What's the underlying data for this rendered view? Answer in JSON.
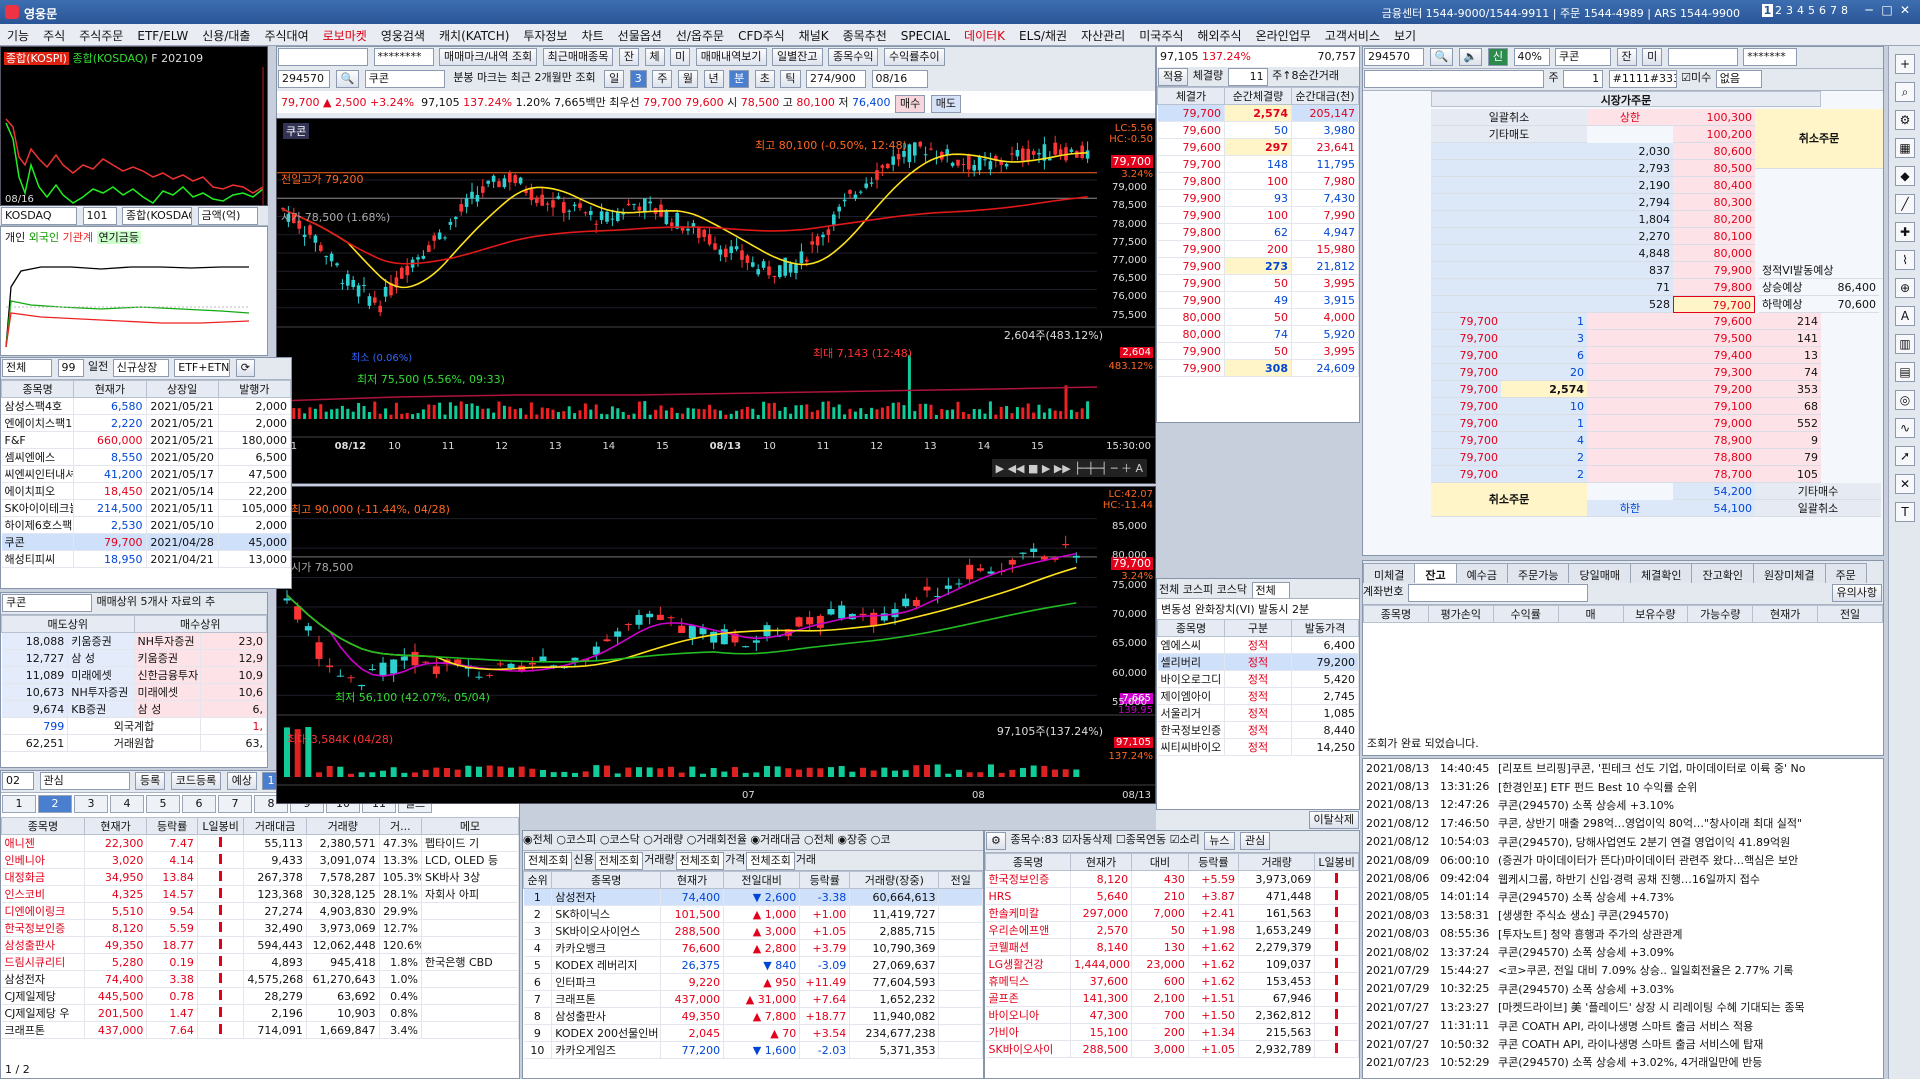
{
  "window": {
    "title": "영웅문",
    "contact": "금융센터 1544-9000/1544-9911 | 주문 1544-4989 | ARS 1544-9900",
    "pages": [
      "1",
      "2",
      "3",
      "4",
      "5",
      "6",
      "7",
      "8"
    ],
    "window_controls": [
      "─",
      "□",
      "✕"
    ]
  },
  "menu": [
    "기능",
    "주식",
    "주식주문",
    "ETF/ELW",
    "신용/대출",
    "주식대여",
    "로보마켓",
    "영웅검색",
    "캐치(KATCH)",
    "투자정보",
    "차트",
    "선물옵션",
    "선/옵주문",
    "CFD주식",
    "채널K",
    "종목추천",
    "SPECIAL",
    "데이터K",
    "ELS/채권",
    "자산관리",
    "미국주식",
    "해외주식",
    "온라인업무",
    "고객서비스",
    "보기"
  ],
  "menu_red": [
    "로보마켓",
    "데이터K"
  ],
  "mini_index": {
    "legend": [
      "종합(KOSPI)",
      "종합(KOSDAQ)",
      "F 202109"
    ],
    "date": "08/16",
    "controls": [
      "KOSDAQ",
      "101",
      "종합(KOSDAQ)",
      "금액(억)"
    ],
    "investors": [
      "개인",
      "외국인",
      "기관계",
      "연기금등"
    ],
    "date2": "08/16"
  },
  "listing_table": {
    "controls": [
      "전체",
      "99",
      "일전",
      "신규상장",
      "ETF+ETN"
    ],
    "headers": [
      "종목명",
      "현재가",
      "상장일",
      "발행가"
    ],
    "rows": [
      [
        "삼성스팩4호",
        "6,580",
        "2021/05/21",
        "2,000"
      ],
      [
        "엔에이치스팩19",
        "2,220",
        "2021/05/21",
        "2,000"
      ],
      [
        "F&F",
        "660,000",
        "2021/05/21",
        "180,000"
      ],
      [
        "셈씨엔에스",
        "8,550",
        "2021/05/20",
        "6,500"
      ],
      [
        "씨엔씨인터내셔",
        "41,200",
        "2021/05/17",
        "47,500"
      ],
      [
        "에이치피오",
        "18,450",
        "2021/05/14",
        "22,200"
      ],
      [
        "SK아이이테크놀",
        "214,500",
        "2021/05/11",
        "105,000"
      ],
      [
        "하이제6호스팩",
        "2,530",
        "2021/05/10",
        "2,000"
      ],
      [
        "쿠콘",
        "79,700",
        "2021/04/28",
        "45,000"
      ],
      [
        "해성티피씨",
        "18,950",
        "2021/04/21",
        "13,000"
      ]
    ]
  },
  "broker": {
    "search_code": "쿠콘",
    "info": "매매상위 5개사 자료의 추",
    "headers": [
      "매도상위",
      "매수상위"
    ],
    "rows": [
      [
        "18,088",
        "키움증권",
        "NH투자증권",
        "23,0"
      ],
      [
        "12,727",
        "삼 성",
        "키움증권",
        "12,9"
      ],
      [
        "11,089",
        "미래에셋",
        "신한금융투자",
        "10,9"
      ],
      [
        "10,673",
        "NH투자증권",
        "미래에셋",
        "10,6"
      ],
      [
        "9,674",
        "KB증권",
        "삼 성",
        "6,"
      ]
    ],
    "foreign_label": "외국계합",
    "foreign_value": "799",
    "foreign_right": "1,",
    "total_label": "거래원합",
    "total_value": "62,251",
    "total_right": "63,"
  },
  "watch": {
    "controls": [
      "02",
      "관심",
      "등록",
      "코드등록",
      "예상",
      "1",
      "2",
      "3",
      "4",
      "5"
    ],
    "tabs": [
      "1",
      "2",
      "3",
      "4",
      "5",
      "6",
      "7",
      "8",
      "9",
      "10",
      "11"
    ],
    "filter": "필드",
    "headers": [
      "종목명",
      "현재가",
      "등락률",
      "L일봉비",
      "거래대금",
      "거래량",
      "거...",
      "메모"
    ],
    "rows": [
      [
        "애니젠",
        "22,300",
        "7.47",
        "",
        "55,113",
        "2,380,571",
        "47.3%",
        "펩타이드 기"
      ],
      [
        "인베니아",
        "3,020",
        "4.14",
        "",
        "9,433",
        "3,091,074",
        "13.3%",
        "LCD, OLED 등"
      ],
      [
        "대정화금",
        "34,950",
        "13.84",
        "",
        "267,378",
        "7,578,287",
        "105.3%",
        "SK바사 3상"
      ],
      [
        "인스코비",
        "4,325",
        "14.57",
        "",
        "123,368",
        "30,328,125",
        "28.1%",
        "자회사 아피"
      ],
      [
        "디엔에이링크",
        "5,510",
        "9.54",
        "",
        "27,274",
        "4,903,830",
        "29.9%",
        ""
      ],
      [
        "한국정보인증",
        "8,120",
        "5.59",
        "",
        "32,490",
        "3,973,069",
        "12.7%",
        ""
      ],
      [
        "삼성출판사",
        "49,350",
        "18.77",
        "",
        "594,443",
        "12,062,448",
        "120.6%",
        ""
      ],
      [
        "드림시큐리티",
        "5,280",
        "0.19",
        "",
        "4,893",
        "945,418",
        "1.8%",
        "한국은행 CBD"
      ],
      [
        "삼성전자",
        "74,400",
        "3.38",
        "",
        "4,575,268",
        "61,270,643",
        "1.0%",
        ""
      ],
      [
        "CJ제일제당",
        "445,500",
        "0.78",
        "",
        "28,279",
        "63,692",
        "0.4%",
        ""
      ],
      [
        "CJ제일제당 우",
        "201,500",
        "1.47",
        "",
        "2,196",
        "10,903",
        "0.8%",
        ""
      ],
      [
        "크래프톤",
        "437,000",
        "7.64",
        "",
        "714,091",
        "1,669,847",
        "3.4%",
        ""
      ]
    ],
    "pages": "1 / 2"
  },
  "chart_header": {
    "code": "294570",
    "name": "쿠콘",
    "note": "분봉 마크는 최근 2개월만 조회",
    "buttons": [
      "매매마크/내역 조회",
      "최근매매종목",
      "잔",
      "체",
      "미",
      "매매내역보기",
      "일별잔고",
      "종목수익",
      "수익률추이"
    ],
    "periods": [
      "일",
      "주",
      "월",
      "년",
      "분",
      "초",
      "틱"
    ],
    "period_value": "3",
    "tick_value": "274/900",
    "date": "08/16",
    "price": "79,700",
    "arrow": "▲",
    "change": "2,500",
    "rate": "+3.24%",
    "volume": "97,105",
    "vol_rate": "137.24%",
    "turnover": "1.20%",
    "amount": "7,665백만",
    "high_label": "최우선",
    "ask": "79,700",
    "bid": "79,600",
    "open": "78,500",
    "high": "80,100",
    "low": "76,400",
    "sell": "매수",
    "buy": "매도"
  },
  "intraday_chart": {
    "name": "쿠콘",
    "max_note": "최고 80,100 (-0.50%, 12:48)",
    "min_note": "최저 75,500 (5.56%, 09:33)",
    "prev_high": "전일고가 79,200",
    "prev_close": "시가 78,500 (1.68%)",
    "lc": "LC:5.56",
    "hc": "HC:-0.50",
    "last_price": "79,700",
    "last_rate": "3.24%",
    "y_ticks": [
      "79,000",
      "78,500",
      "78,000",
      "77,500",
      "77,000",
      "76,500",
      "76,000",
      "75,500"
    ],
    "vol_note": "2,604주(483.12%)",
    "vol_max": "최대 7,143 (12:48)",
    "vol_last": "2,604",
    "vol_rate": "483.12%",
    "vol_low": "최소 (0.06%)",
    "x_labels": [
      "/11",
      "08/12",
      "10",
      "11",
      "12",
      "13",
      "14",
      "15",
      "08/13",
      "10",
      "11",
      "12",
      "13",
      "14",
      "15",
      "15:30:00"
    ]
  },
  "daily_chart": {
    "max_note": "최고 90,000 (-11.44%, 04/28)",
    "min_note": "최저 56,100 (42.07%, 05/04)",
    "prev": "시가 78,500",
    "lc": "LC:42.07",
    "hc": "HC:-11.44",
    "last_price": "79,700",
    "last_rate": "3.24%",
    "y_ticks": [
      "85,000",
      "80,000",
      "75,000",
      "70,000",
      "65,000",
      "60,000",
      "55,000"
    ],
    "ma_value": "7,665",
    "ma_rate": "139.95",
    "vol_note": "97,105주(137.24%)",
    "vol_max": "최대 3,584K (04/28)",
    "vol_last": "97,105",
    "vol_rate": "137.24%",
    "x_labels": [
      "07",
      "08",
      "08/13"
    ]
  },
  "ticks": {
    "header_left": "97,105",
    "header_rate": "137.24%",
    "header_right": "70,757",
    "sub": [
      "적용",
      "체결량",
      "11",
      "주↑8순간거래"
    ],
    "headers": [
      "체결가",
      "순간체결량",
      "순간대금(천)"
    ],
    "rows": [
      [
        "79,700",
        "2,574",
        "205,147"
      ],
      [
        "79,600",
        "50",
        "3,980"
      ],
      [
        "79,600",
        "297",
        "23,641"
      ],
      [
        "79,700",
        "148",
        "11,795"
      ],
      [
        "79,800",
        "100",
        "7,980"
      ],
      [
        "79,900",
        "93",
        "7,430"
      ],
      [
        "79,900",
        "100",
        "7,990"
      ],
      [
        "79,800",
        "62",
        "4,947"
      ],
      [
        "79,900",
        "200",
        "15,980"
      ],
      [
        "79,900",
        "273",
        "21,812"
      ],
      [
        "79,900",
        "50",
        "3,995"
      ],
      [
        "79,900",
        "49",
        "3,915"
      ],
      [
        "80,000",
        "50",
        "4,000"
      ],
      [
        "80,000",
        "74",
        "5,920"
      ],
      [
        "79,900",
        "50",
        "3,995"
      ],
      [
        "79,900",
        "308",
        "24,609"
      ]
    ]
  },
  "vi": {
    "radios": [
      "전체",
      "코스피",
      "코스닥"
    ],
    "select": "전체",
    "note": "변동성 완화장치(VI) 발동시 2분",
    "headers": [
      "종목명",
      "구분",
      "발동가격"
    ],
    "rows": [
      [
        "엠에스씨",
        "정적",
        "6,400"
      ],
      [
        "셀리버리",
        "정적",
        "79,200"
      ],
      [
        "바이오로그디",
        "정적",
        "5,420"
      ],
      [
        "제이엠아이",
        "정적",
        "2,745"
      ],
      [
        "서울리거",
        "정적",
        "1,085"
      ],
      [
        "한국정보인증",
        "정적",
        "8,440"
      ],
      [
        "씨티씨바이오",
        "정적",
        "14,250"
      ]
    ],
    "button": "이탈삭제"
  },
  "ranking": {
    "radios1": [
      "전체",
      "코스피",
      "코스닥",
      "거래량",
      "거래회전율",
      "거래대금"
    ],
    "radios2": [
      "전체",
      "장중",
      "코"
    ],
    "selects": [
      "전체조회",
      "신용",
      "전체조회",
      "거래량",
      "전체조회",
      "가격",
      "전체조회",
      "거래"
    ],
    "headers": [
      "순위",
      "종목명",
      "현재가",
      "전일대비",
      "등락률",
      "거래량(장중)",
      "전일"
    ],
    "rows": [
      [
        "1",
        "삼성전자",
        "74,400",
        "▼",
        "2,600",
        "-3.38",
        "60,664,613"
      ],
      [
        "2",
        "SK하이닉스",
        "101,500",
        "▲",
        "1,000",
        "+1.00",
        "11,419,727"
      ],
      [
        "3",
        "SK바이오사이언스",
        "288,500",
        "▲",
        "3,000",
        "+1.05",
        "2,885,715"
      ],
      [
        "4",
        "카카오뱅크",
        "76,600",
        "▲",
        "2,800",
        "+3.79",
        "10,790,369"
      ],
      [
        "5",
        "KODEX 레버리지",
        "26,375",
        "▼",
        "840",
        "-3.09",
        "27,069,637"
      ],
      [
        "6",
        "인터파크",
        "9,220",
        "▲",
        "950",
        "+11.49",
        "77,604,593"
      ],
      [
        "7",
        "크래프톤",
        "437,000",
        "▲",
        "31,000",
        "+7.64",
        "1,652,232"
      ],
      [
        "8",
        "삼성출판사",
        "49,350",
        "▲",
        "7,800",
        "+18.77",
        "11,940,082"
      ],
      [
        "9",
        "KODEX 200선물인버",
        "2,045",
        "▲",
        "70",
        "+3.54",
        "234,677,238"
      ],
      [
        "10",
        "카카오게임즈",
        "77,200",
        "▼",
        "1,600",
        "-2.03",
        "5,371,353"
      ]
    ]
  },
  "vi_watch": {
    "count_label": "종목수:83",
    "checks": [
      "자동삭제",
      "종목연동",
      "소리"
    ],
    "buttons": [
      "뉴스",
      "관심"
    ],
    "headers": [
      "종목명",
      "현재가",
      "대비",
      "등락률",
      "거래량",
      "L일봉비"
    ],
    "rows": [
      [
        "한국정보인증",
        "8,120",
        "430",
        "+5.59",
        "3,973,069"
      ],
      [
        "HRS",
        "5,640",
        "210",
        "+3.87",
        "471,448"
      ],
      [
        "한솔케미칼",
        "297,000",
        "7,000",
        "+2.41",
        "161,563"
      ],
      [
        "우리손에프앤",
        "2,570",
        "50",
        "+1.98",
        "1,653,249"
      ],
      [
        "코웰패션",
        "8,140",
        "130",
        "+1.62",
        "2,279,379"
      ],
      [
        "LG생활건강",
        "1,444,000",
        "23,000",
        "+1.62",
        "109,037"
      ],
      [
        "휴메딕스",
        "37,600",
        "600",
        "+1.62",
        "153,453"
      ],
      [
        "골프존",
        "141,300",
        "2,100",
        "+1.51",
        "67,946"
      ],
      [
        "바이오니아",
        "47,300",
        "700",
        "+1.50",
        "2,362,812"
      ],
      [
        "가비아",
        "15,100",
        "200",
        "+1.34",
        "215,563"
      ],
      [
        "SK바이오사이",
        "288,500",
        "3,000",
        "+1.05",
        "2,932,789"
      ]
    ]
  },
  "orderbook": {
    "code": "294570",
    "name": "쿠콘",
    "pct": "40%",
    "labels": [
      "신",
      "잔",
      "미"
    ],
    "pw": "*******",
    "qty_label": "주",
    "qty": "1",
    "account": "#1111#3333",
    "check_label": "미수",
    "none": "없음",
    "title": "시장가주문",
    "batch_cancel": "일괄취소",
    "upper": "상한",
    "upper_price": "100,300",
    "upper_price2": "100,200",
    "other_sell": "기타매도",
    "cancel": "취소주문",
    "asks": [
      [
        "2,030",
        "80,600"
      ],
      [
        "2,793",
        "80,500"
      ],
      [
        "2,190",
        "80,400"
      ],
      [
        "2,794",
        "80,300"
      ],
      [
        "1,804",
        "80,200"
      ],
      [
        "2,270",
        "80,100"
      ],
      [
        "4,848",
        "80,000"
      ],
      [
        "837",
        "79,900"
      ],
      [
        "71",
        "79,800"
      ],
      [
        "528",
        "79,700"
      ]
    ],
    "vi_title": "정적VI발동예상",
    "vi_up": "상승예상",
    "vi_up_v": "86,400",
    "vi_dn": "하락예상",
    "vi_dn_v": "70,600",
    "bids": [
      [
        "79,600",
        "214"
      ],
      [
        "79,500",
        "141"
      ],
      [
        "79,400",
        "13"
      ],
      [
        "79,300",
        "74"
      ],
      [
        "79,200",
        "353"
      ],
      [
        "79,100",
        "68"
      ],
      [
        "79,000",
        "552"
      ],
      [
        "78,900",
        "9"
      ],
      [
        "78,800",
        "79"
      ],
      [
        "78,700",
        "105"
      ]
    ],
    "fills": [
      [
        "79,700",
        "1"
      ],
      [
        "79,700",
        "3"
      ],
      [
        "79,700",
        "6"
      ],
      [
        "79,700",
        "20"
      ],
      [
        "79,700",
        "2,574"
      ],
      [
        "79,700",
        "10"
      ],
      [
        "79,700",
        "1"
      ],
      [
        "79,700",
        "4"
      ],
      [
        "79,700",
        "2"
      ],
      [
        "79,700",
        "2"
      ]
    ],
    "lower_a": "54,200",
    "other_buy": "기타매수",
    "lower_b": "54,100",
    "lower": "하한",
    "batch_cancel2": "일괄취소"
  },
  "balance": {
    "tabs": [
      "미체결",
      "잔고",
      "예수금",
      "주문가능",
      "당일매매",
      "체결확인",
      "잔고확인",
      "원장미체결",
      "주문"
    ],
    "account_label": "계좌번호",
    "button": "유의사항",
    "headers": [
      "종목명",
      "평가손익",
      "수익률",
      "매",
      "보유수량",
      "가능수량",
      "현재가",
      "전일"
    ],
    "status": "조회가 완료 되었습니다."
  },
  "news": [
    [
      "2021/08/13",
      "14:40:45",
      "[리포트 브리핑]쿠콘, '핀테크 선도 기업, 마이데이터로 이륙 중' No"
    ],
    [
      "2021/08/13",
      "13:31:26",
      "[한경인포] ETF 펀드 Best 10 수익률 순위"
    ],
    [
      "2021/08/13",
      "12:47:26",
      "쿠콘(294570)  소폭 상승세 +3.10%"
    ],
    [
      "2021/08/12",
      "17:46:50",
      "쿠콘, 상반기 매출 298억…영업이익 80억…\"창사이래 최대 실적\""
    ],
    [
      "2021/08/12",
      "10:54:03",
      "쿠콘(294570), 당해사업연도 2분기 연결 영업이익 41.89억원"
    ],
    [
      "2021/08/09",
      "06:00:10",
      "(증권가 마이데이터가 뜬다)마이데이터 관련주 왔다…핵심은 보안"
    ],
    [
      "2021/08/06",
      "09:42:04",
      "웹케시그룹, 하반기 신입·경력 공채 진행…16일까지 접수"
    ],
    [
      "2021/08/05",
      "14:01:14",
      "쿠콘(294570)  소폭 상승세 +4.73%"
    ],
    [
      "2021/08/03",
      "13:58:31",
      "[생생한 주식쇼 생쇼] 쿠콘(294570)"
    ],
    [
      "2021/08/03",
      "08:55:36",
      "[투자노트] 청약 흥행과 주가의 상관관계"
    ],
    [
      "2021/08/02",
      "13:37:24",
      "쿠콘(294570)  소폭 상승세 +3.09%"
    ],
    [
      "2021/07/29",
      "15:44:27",
      "<코>쿠콘, 전일 대비 7.09% 상승.. 일일회전율은 2.77% 기록"
    ],
    [
      "2021/07/29",
      "10:32:25",
      "쿠콘(294570)  소폭 상승세 +3.03%"
    ],
    [
      "2021/07/27",
      "13:23:27",
      "[마켓드라이브] 美 '플레이드' 상장 시 리레이팅 수혜 기대되는 종목"
    ],
    [
      "2021/07/27",
      "11:31:11",
      "쿠콘 COATH API, 라이나생명 스마트 출금 서비스 적용"
    ],
    [
      "2021/07/27",
      "10:50:32",
      "쿠콘 COATH API, 라이나생명 스마트 출금 서비스에 탑재"
    ],
    [
      "2021/07/23",
      "10:52:29",
      "쿠콘(294570)  소폭 상승세 +3.02%, 4거래일만에 반등"
    ]
  ],
  "colors": {
    "up": "#e3001b",
    "down": "#0046d5",
    "brand": "#2a5597"
  }
}
